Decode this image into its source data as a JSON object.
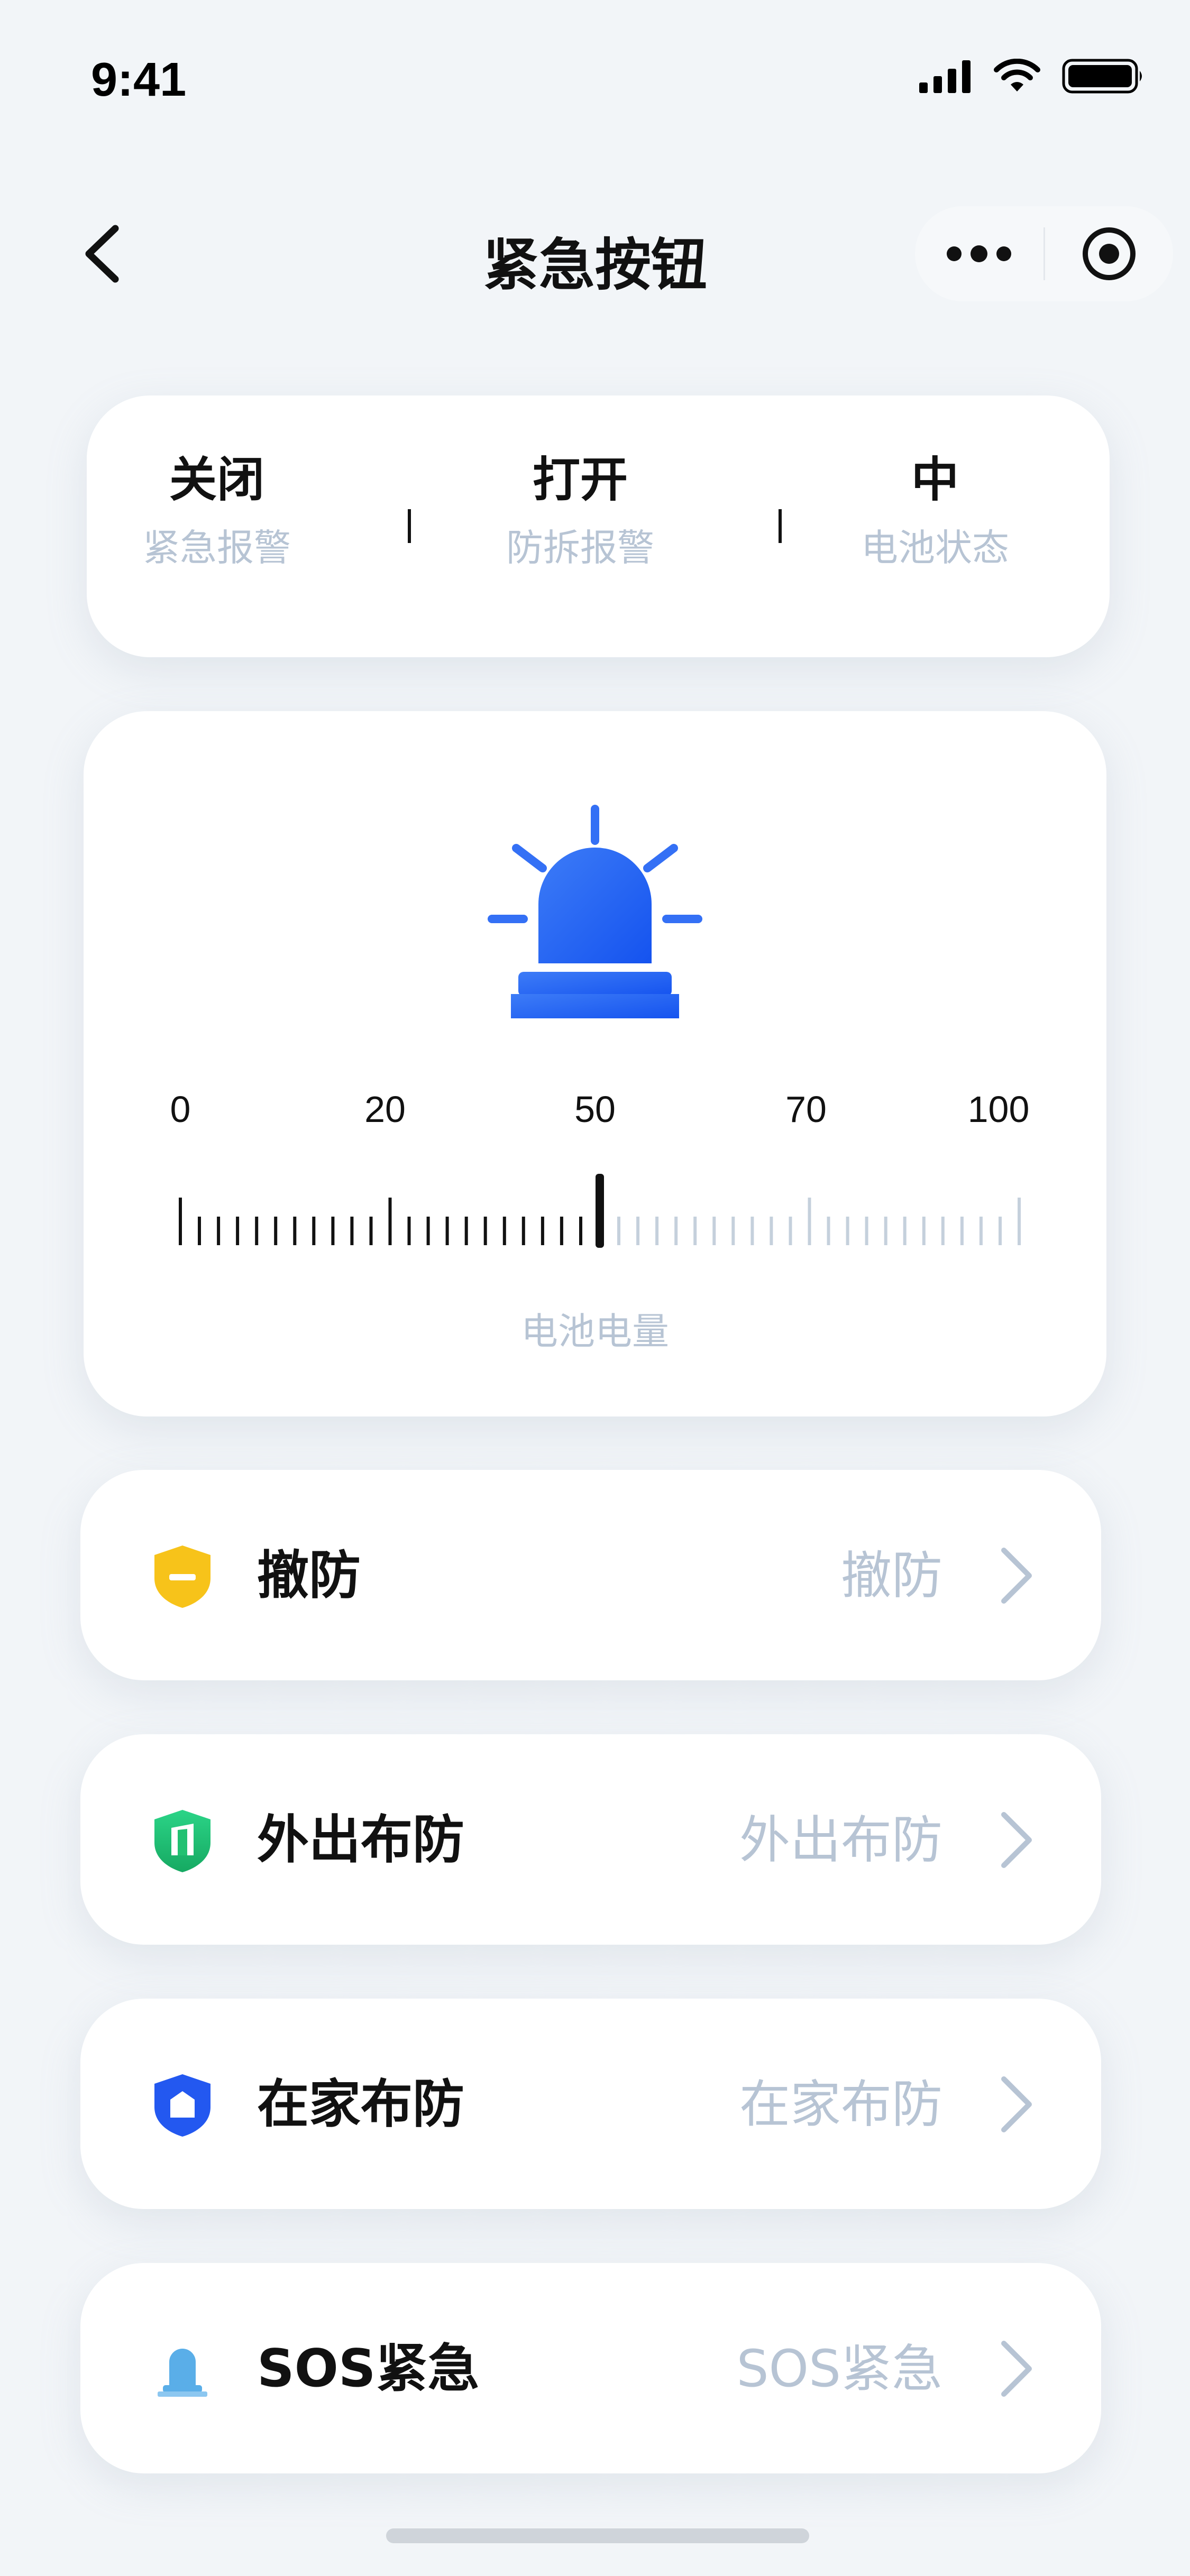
{
  "status_bar": {
    "time": "9:41"
  },
  "nav": {
    "title": "紧急按钮",
    "more_icon": "more-dots-icon",
    "target_icon": "target-icon"
  },
  "status_summary": [
    {
      "value": "关闭",
      "label": "紧急报警"
    },
    {
      "value": "打开",
      "label": "防拆报警"
    },
    {
      "value": "中",
      "label": "电池状态"
    }
  ],
  "battery": {
    "icon": "alarm-siren-icon",
    "scale_labels": [
      "0",
      "20",
      "50",
      "70",
      "100"
    ],
    "level_percent": 50,
    "caption": "电池电量",
    "accent_color": "#1f5ef5"
  },
  "modes": [
    {
      "label": "撤防",
      "value": "撤防",
      "icon": "shield-minus-icon",
      "color": "#f7c31a"
    },
    {
      "label": "外出布防",
      "value": "外出布防",
      "icon": "shield-door-icon",
      "color": "#22c172"
    },
    {
      "label": "在家布防",
      "value": "在家布防",
      "icon": "shield-home-icon",
      "color": "#2358f0"
    },
    {
      "label": "SOS紧急",
      "value": "SOS紧急",
      "icon": "alarm-bell-icon",
      "color": "#5aaee8"
    }
  ]
}
